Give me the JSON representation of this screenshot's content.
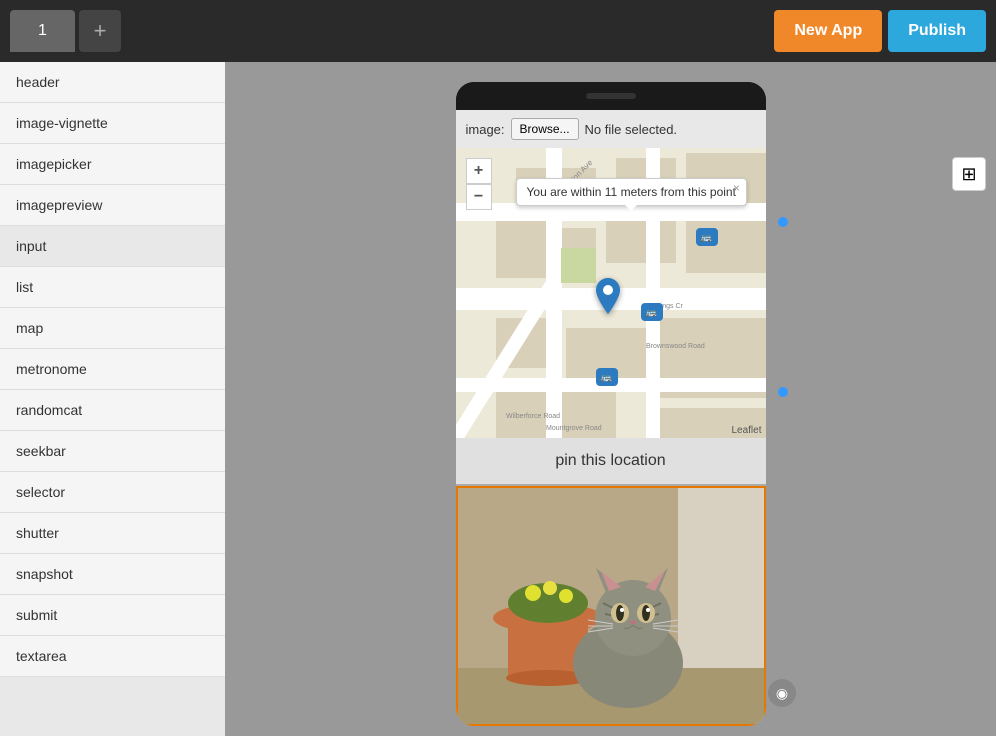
{
  "topbar": {
    "tab_number": "1",
    "tab_add_label": "+",
    "new_app_label": "New App",
    "publish_label": "Publish"
  },
  "sidebar": {
    "items": [
      {
        "label": "header"
      },
      {
        "label": "image-vignette"
      },
      {
        "label": "imagepicker"
      },
      {
        "label": "imagepreview"
      },
      {
        "label": "input"
      },
      {
        "label": "list"
      },
      {
        "label": "map"
      },
      {
        "label": "metronome"
      },
      {
        "label": "randomcat"
      },
      {
        "label": "seekbar"
      },
      {
        "label": "selector"
      },
      {
        "label": "shutter"
      },
      {
        "label": "snapshot"
      },
      {
        "label": "submit"
      },
      {
        "label": "textarea"
      }
    ]
  },
  "canvas": {
    "image_label": "image:",
    "browse_label": "Browse...",
    "no_file_label": "No file selected.",
    "map_zoom_in": "+",
    "map_zoom_out": "−",
    "map_tooltip": "You are within 11 meters from this point",
    "map_tooltip_close": "×",
    "leaflet_attr": "Leaflet",
    "pin_location_label": "pin this location"
  },
  "icons": {
    "sound_icon": "◉",
    "grid_icon": "⊞",
    "pin_icon": "📍"
  }
}
